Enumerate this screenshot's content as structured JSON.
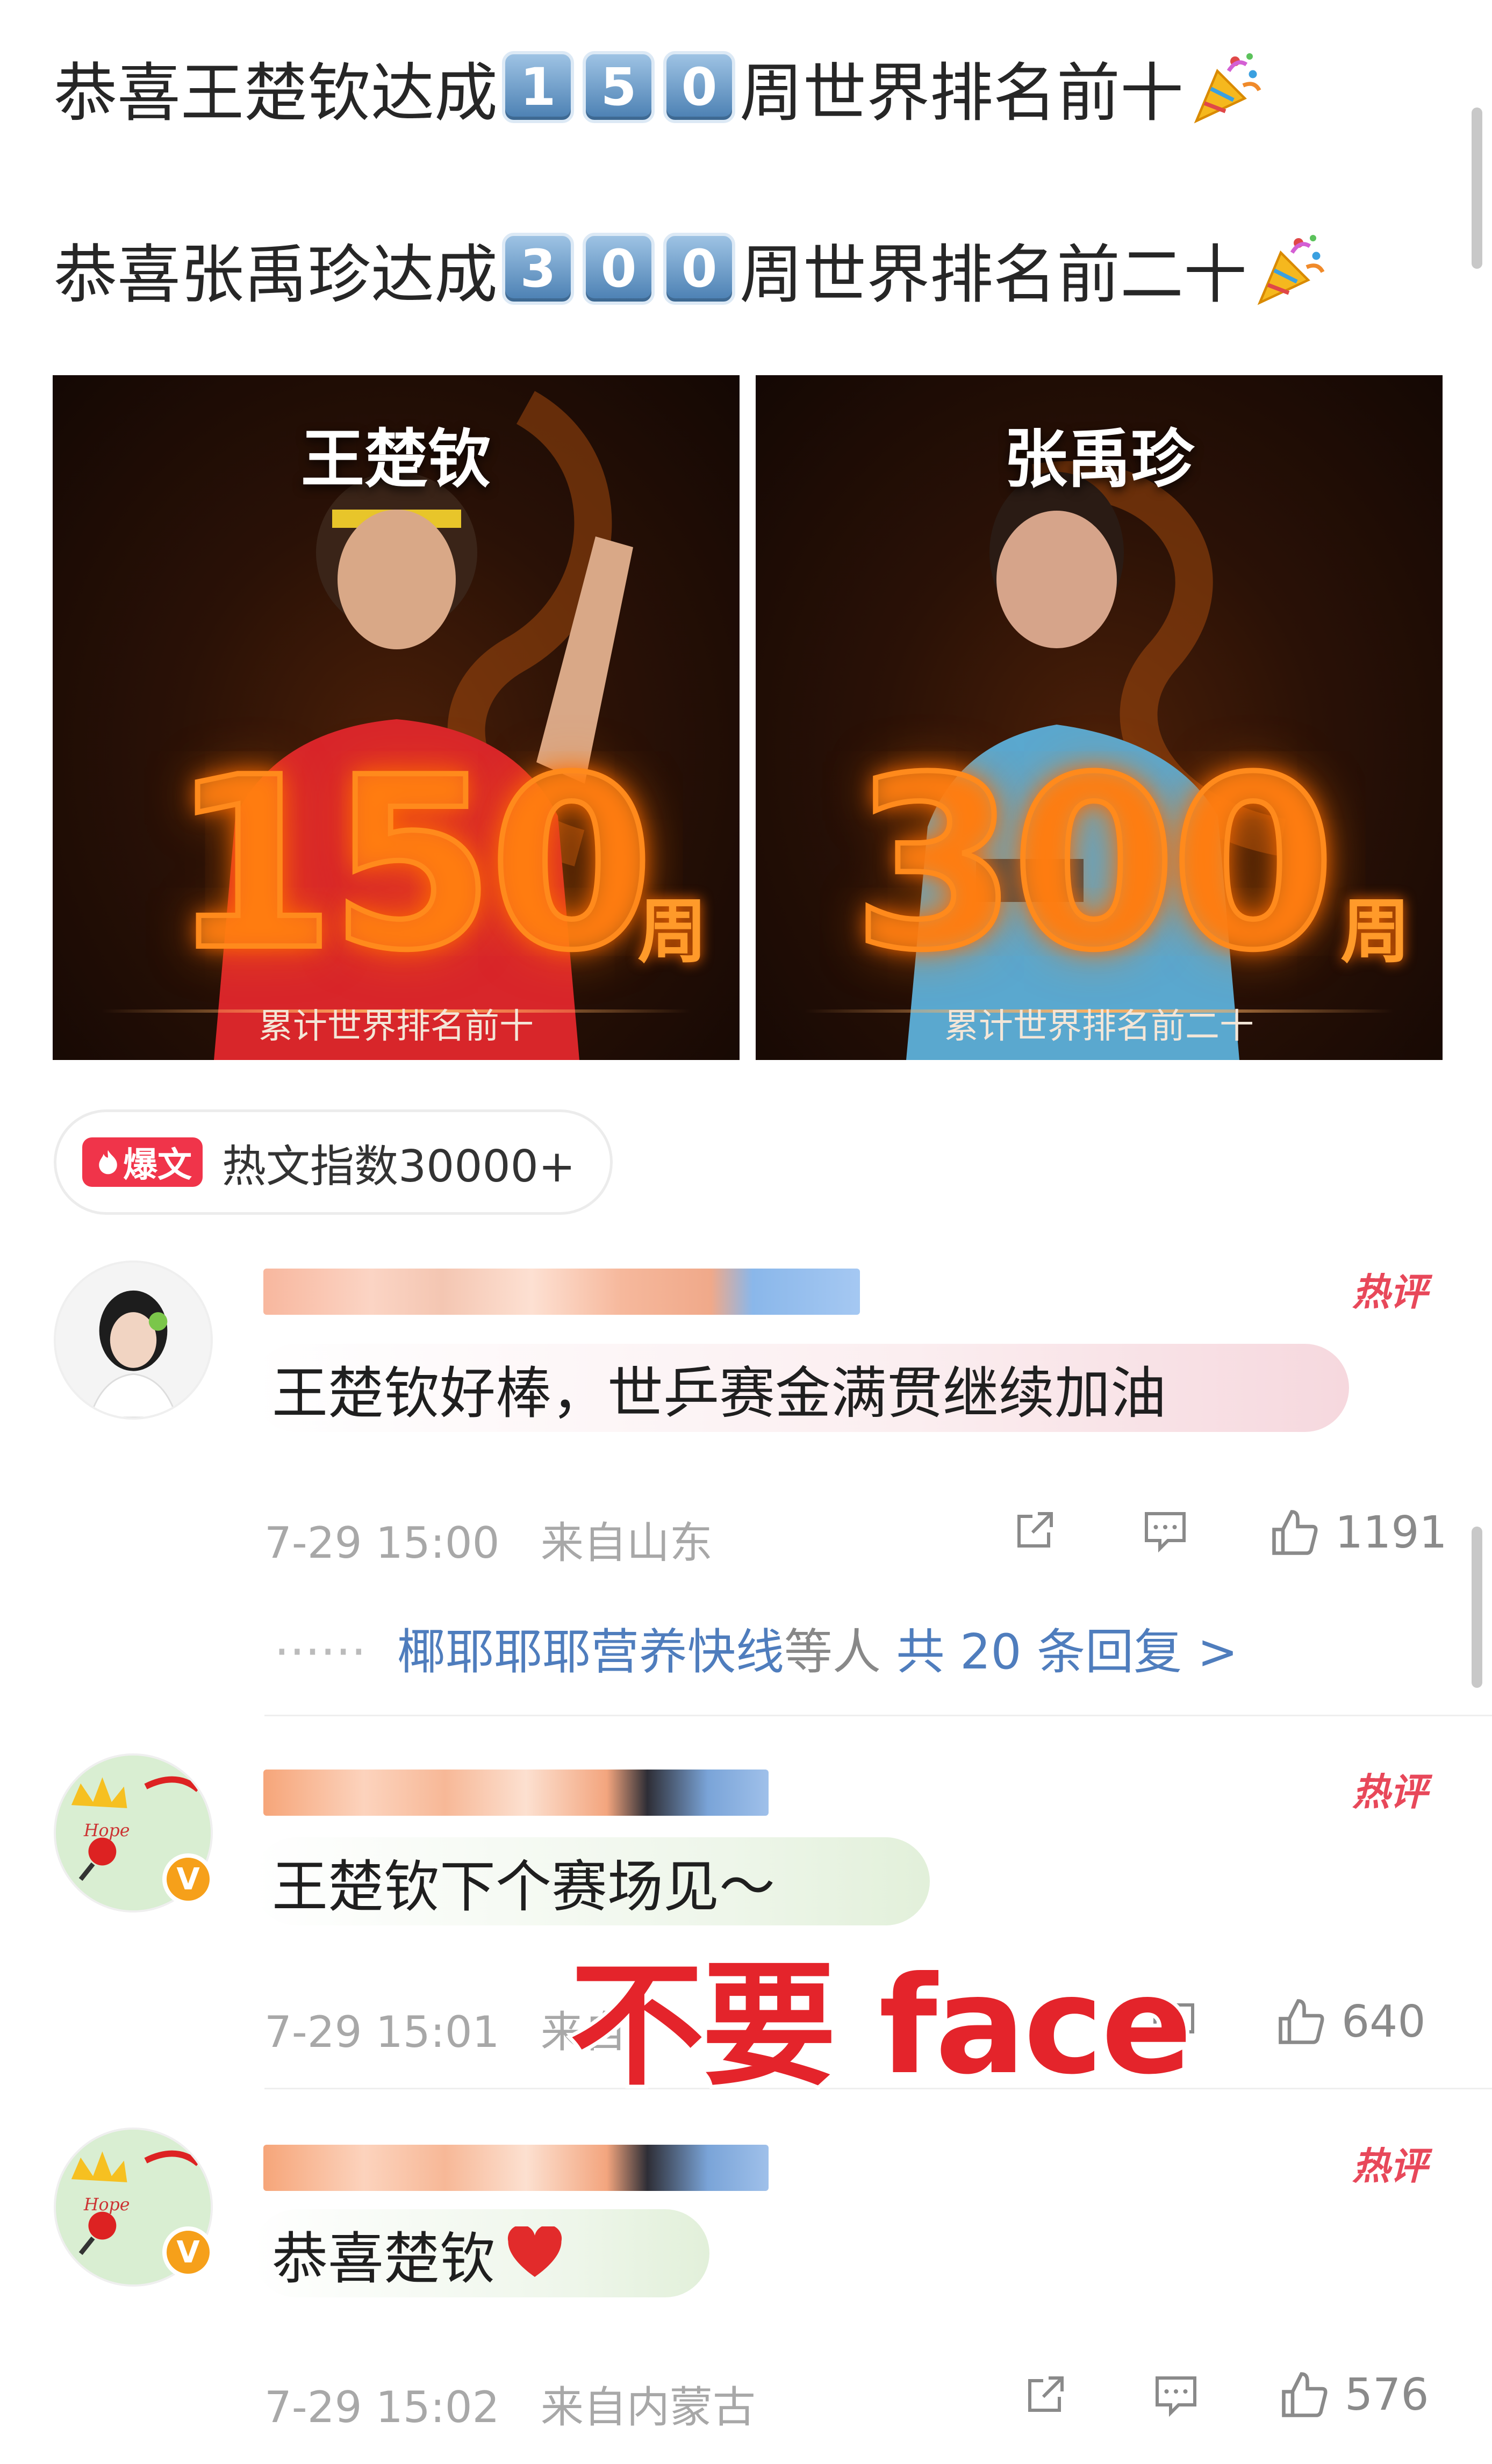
{
  "post": {
    "line1": {
      "prefix": "恭喜王楚钦达成",
      "digits": [
        "1",
        "5",
        "0"
      ],
      "suffix": "周世界排名前十"
    },
    "line2": {
      "prefix": "恭喜张禹珍达成",
      "digits": [
        "3",
        "0",
        "0"
      ],
      "suffix": "周世界排名前二十"
    }
  },
  "promo_images": [
    {
      "name": "王楚钦",
      "number": "150",
      "unit": "周",
      "caption": "累计世界排名前十"
    },
    {
      "name": "张禹珍",
      "number": "300",
      "unit": "周",
      "caption": "累计世界排名前二十"
    }
  ],
  "hot_badge": {
    "tag": "爆文",
    "text": "热文指数30000+"
  },
  "comments": [
    {
      "hot_label": "热评",
      "text": "王楚钦好棒，世乒赛金满贯继续加油",
      "time": "7-29 15:00",
      "location": "来自山东",
      "likes": "1191",
      "replies": {
        "names": "椰耶耶耶营养快线",
        "mid": "等人",
        "total": "共 20 条回复 >"
      }
    },
    {
      "hot_label": "热评",
      "text": "王楚钦下个赛场见～",
      "time": "7-29 15:01",
      "location": "来自",
      "likes": "640"
    },
    {
      "hot_label": "热评",
      "text": "恭喜楚钦",
      "time": "7-29 15:02",
      "location": "来自内蒙古",
      "likes": "576"
    }
  ],
  "watermark": "不要 face",
  "colors": {
    "hot": "#e8485a",
    "link": "#4f7dbd",
    "meta": "#a8a8a8",
    "tag": "#f0344a"
  }
}
